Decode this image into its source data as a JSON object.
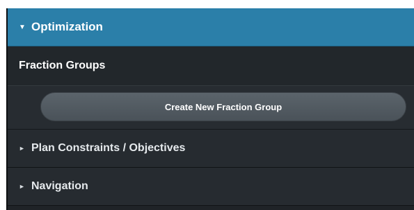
{
  "optimization": {
    "arrow": "▼",
    "title": "Optimization"
  },
  "fraction_groups": {
    "label": "Fraction Groups",
    "create_button_label": "Create New Fraction Group"
  },
  "plan_constraints": {
    "arrow": "►",
    "title": "Plan Constraints / Objectives"
  },
  "navigation": {
    "arrow": "►",
    "title": "Navigation"
  },
  "colors": {
    "accent": "#2b7fa9",
    "panel_bg": "#1f2327",
    "button_bg": "#555e65"
  }
}
